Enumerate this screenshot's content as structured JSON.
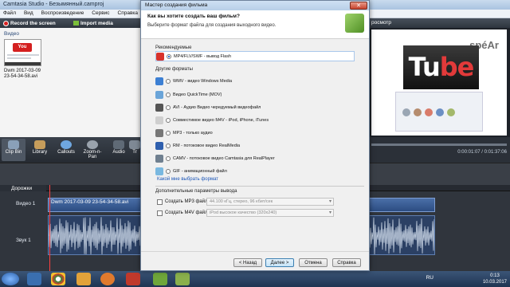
{
  "app": {
    "title": "Camtasia Studio - Безымянный.camproj",
    "menu": [
      "Файл",
      "Вид",
      "Воспроизведение",
      "Сервис",
      "Справка"
    ],
    "toolbar": {
      "record": "Record the screen",
      "import": "Import media"
    }
  },
  "clip_bin": {
    "section": "Видео",
    "clip_name": "Dwm 2017-03-09 23-54-34-58.avi"
  },
  "preview": {
    "header": "росмотр",
    "time": "0:00:01:07 / 0:01:37:06",
    "watermark": "spéAr"
  },
  "tools": [
    "Clip Bin",
    "Library",
    "Callouts",
    "Zoom-n-Pan",
    "Audio",
    "Tr"
  ],
  "timeline": {
    "tracks_label": "Дорожки",
    "video_track": "Видео 1",
    "audio_track": "Звук 1",
    "video_clip": "Dwm 2017-03-09 23-54-34-58.avi"
  },
  "taskbar": {
    "lang": "RU",
    "time": "0:13",
    "date": "10.03.2017"
  },
  "dialog": {
    "title": "Мастер создания фильма",
    "question": "Как вы хотите создать ваш фильм?",
    "subtitle": "Выберите формат файла для создания выходного видео.",
    "recommended_group": "Рекомендуемые",
    "other_group": "Другие форматы",
    "options": [
      {
        "label": "MP4/FLV/SWF - вывод Flash",
        "selected": true,
        "color": "#d8322b"
      },
      {
        "label": "WMV - видео Windows Media",
        "selected": false,
        "color": "#3c7fd3"
      },
      {
        "label": "Видео QuickTime (MOV)",
        "selected": false,
        "color": "#6aa4d8"
      },
      {
        "label": "AVI - Аудио Видео чередуемый видеофайл",
        "selected": false,
        "color": "#555555"
      },
      {
        "label": "Совместимое видео M4V - iPod, iPhone, iTunes",
        "selected": false,
        "color": "#cfcfcf"
      },
      {
        "label": "MP3 - только аудио",
        "selected": false,
        "color": "#777777"
      },
      {
        "label": "RM - потоковое видео RealMedia",
        "selected": false,
        "color": "#2f5fae"
      },
      {
        "label": "CAMV - потоковое видео Camtasia для RealPlayer",
        "selected": false,
        "color": "#6f7f8f"
      },
      {
        "label": "GIF - анимационный файл",
        "selected": false,
        "color": "#79b8e0"
      }
    ],
    "help_link": "Какой мне выбрать формат",
    "extra_title": "Дополнительные параметры вывода",
    "extra": [
      {
        "label": "Создать MP3 файл:",
        "value": "44.100 кГц, стерео, 96 кбит/сек"
      },
      {
        "label": "Создать M4V файл:",
        "value": "iPod высокое качество (320x240)"
      }
    ],
    "buttons": {
      "back": "< Назад",
      "next": "Далее >",
      "cancel": "Отмена",
      "help": "Справка"
    }
  }
}
